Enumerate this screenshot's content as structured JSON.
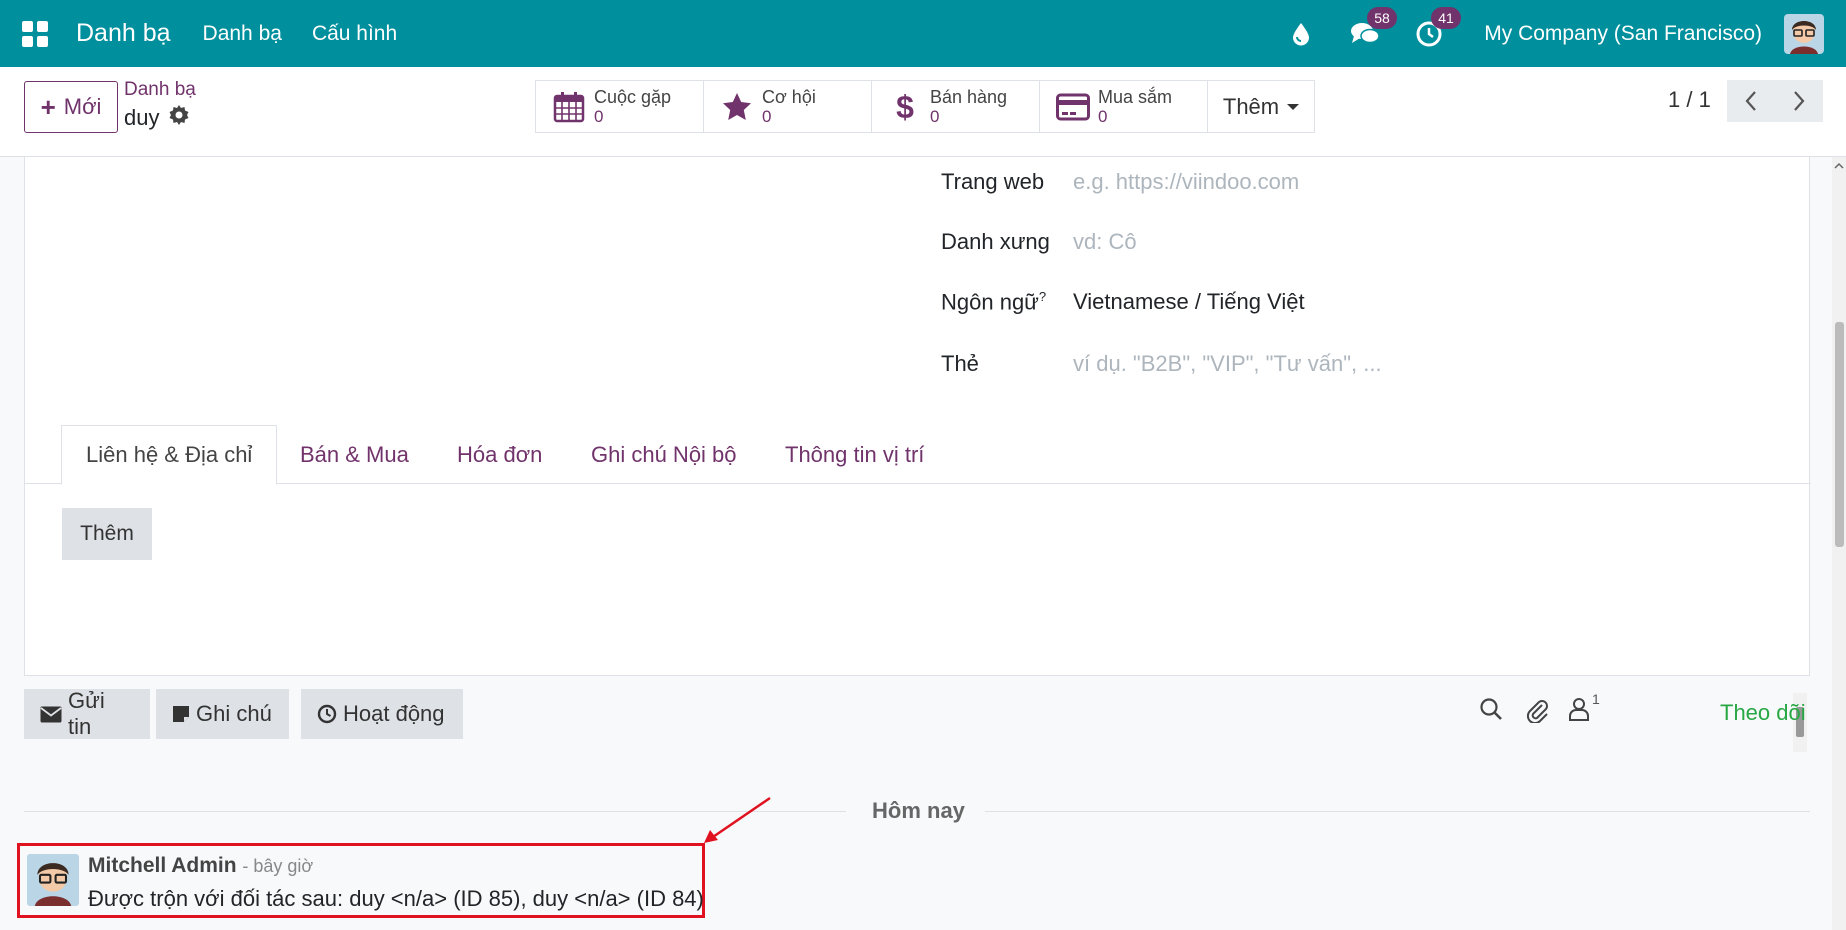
{
  "navbar": {
    "brand": "Danh bạ",
    "menu": [
      "Danh bạ",
      "Cấu hình"
    ],
    "messages_count": "58",
    "activities_count": "41",
    "company": "My Company (San Francisco)"
  },
  "control_panel": {
    "new_button": "Mới",
    "breadcrumb": "Danh bạ",
    "record_name": "duy",
    "smart_buttons": [
      {
        "label": "Cuộc gặp",
        "value": "0",
        "icon": "calendar-icon"
      },
      {
        "label": "Cơ hội",
        "value": "0",
        "icon": "star-icon"
      },
      {
        "label": "Bán hàng",
        "value": "0",
        "icon": "dollar-icon"
      },
      {
        "label": "Mua sắm",
        "value": "0",
        "icon": "credit-card-icon"
      }
    ],
    "more_button": "Thêm",
    "pager": "1 / 1"
  },
  "form": {
    "fields": [
      {
        "label": "Trang web",
        "placeholder": "e.g. https://viindoo.com"
      },
      {
        "label": "Danh xưng",
        "placeholder": "vd: Cô"
      },
      {
        "label": "Ngôn ngữ",
        "help": "?",
        "value": "Vietnamese / Tiếng Việt"
      },
      {
        "label": "Thẻ",
        "placeholder": "ví dụ. \"B2B\", \"VIP\", \"Tư vấn\", ..."
      }
    ],
    "tabs": [
      "Liên hệ & Địa chỉ",
      "Bán & Mua",
      "Hóa đơn",
      "Ghi chú Nội bộ",
      "Thông tin vị trí"
    ],
    "add_button": "Thêm"
  },
  "chatter": {
    "send_message": "Gửi tin",
    "log_note": "Ghi chú",
    "activity": "Hoạt động",
    "followers_count": "1",
    "follow": "Theo dõi",
    "date_separator": "Hôm nay",
    "message": {
      "author": "Mitchell Admin",
      "time": "- bây giờ",
      "body": "Được trộn với đối tác sau: duy <n/a> (ID 85), duy <n/a> (ID 84)"
    }
  },
  "colors": {
    "navbar": "#008f9c",
    "primary": "#71336b",
    "highlight": "#e0121f",
    "follow": "#28a745"
  }
}
